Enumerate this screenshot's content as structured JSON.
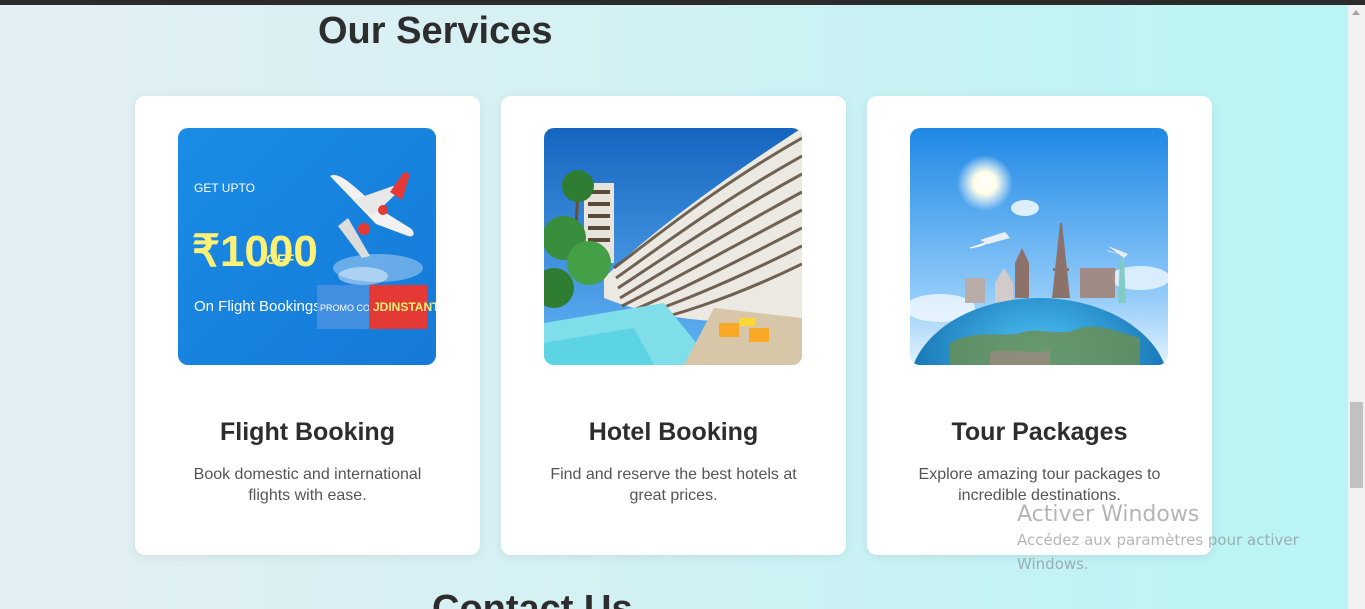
{
  "services": {
    "heading": "Our Services",
    "cards": [
      {
        "title": "Flight Booking",
        "description": "Book domestic and international flights with ease.",
        "image_text": {
          "get_upto": "GET UPTO",
          "amount": "₹1000",
          "off": "OFF",
          "on_flight": "On Flight Bookings",
          "promo_code_label": "PROMO CODE",
          "promo_code": "JDINSTANT"
        }
      },
      {
        "title": "Hotel Booking",
        "description": "Find and reserve the best hotels at great prices."
      },
      {
        "title": "Tour Packages",
        "description": "Explore amazing tour packages to incredible destinations."
      }
    ]
  },
  "contact": {
    "heading": "Contact Us"
  },
  "watermark": {
    "title": "Activer Windows",
    "subtitle": "Accédez aux paramètres pour activer Windows."
  },
  "colors": {
    "card_bg": "#ffffff",
    "heading": "#2d2d2d",
    "text": "#555555",
    "flight_banner_blue": "#1e88e5",
    "promo_red": "#e53935",
    "promo_yellow": "#fff176"
  }
}
